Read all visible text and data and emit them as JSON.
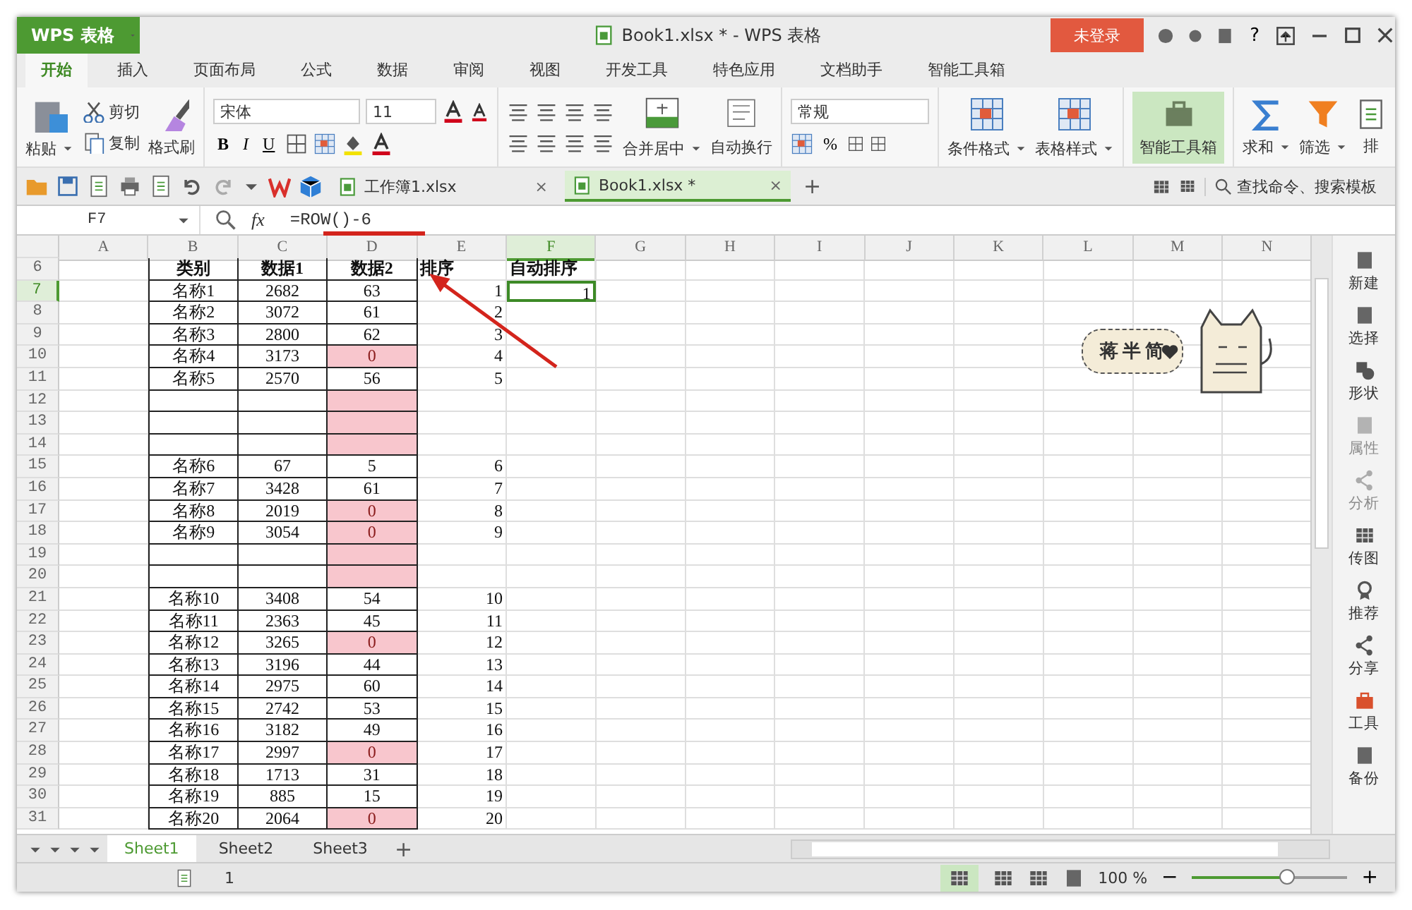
{
  "title_bar": {
    "app": "WPS 表格",
    "document": "Book1.xlsx * - WPS 表格",
    "login": "未登录",
    "help": "?"
  },
  "menu_tabs": [
    {
      "label": "开始",
      "selected": true
    },
    {
      "label": "插入",
      "selected": false
    },
    {
      "label": "页面布局",
      "selected": false
    },
    {
      "label": "公式",
      "selected": false
    },
    {
      "label": "数据",
      "selected": false
    },
    {
      "label": "审阅",
      "selected": false
    },
    {
      "label": "视图",
      "selected": false
    },
    {
      "label": "开发工具",
      "selected": false
    },
    {
      "label": "特色应用",
      "selected": false
    },
    {
      "label": "文档助手",
      "selected": false
    },
    {
      "label": "智能工具箱",
      "selected": false
    }
  ],
  "ribbon": {
    "paste": "粘贴",
    "cut": "剪切",
    "copy": "复制",
    "format_painter": "格式刷",
    "font": "宋体",
    "size": "11",
    "bold": "B",
    "italic": "I",
    "underline": "U",
    "merge": "合并居中",
    "wrap": "自动换行",
    "number_format": "常规",
    "percent": "%",
    "conditional": "条件格式",
    "table_style": "表格样式",
    "toolbox": "智能工具箱",
    "sum": "求和",
    "filter": "筛选",
    "sort": "排"
  },
  "doc_tabs": [
    {
      "label": "工作簿1.xlsx",
      "selected": false,
      "close": "×"
    },
    {
      "label": "Book1.xlsx *",
      "selected": true,
      "close": "×"
    }
  ],
  "new_tab": "+",
  "search": {
    "placeholder": "查找命令、搜索模板"
  },
  "formula_bar": {
    "cell": "F7",
    "fx": "fx",
    "formula": "=ROW()-6"
  },
  "columns": [
    {
      "label": "A",
      "selected": false
    },
    {
      "label": "B",
      "selected": false
    },
    {
      "label": "C",
      "selected": false
    },
    {
      "label": "D",
      "selected": false
    },
    {
      "label": "E",
      "selected": false
    },
    {
      "label": "F",
      "selected": true
    },
    {
      "label": "G",
      "selected": false
    },
    {
      "label": "H",
      "selected": false
    },
    {
      "label": "I",
      "selected": false
    },
    {
      "label": "J",
      "selected": false
    },
    {
      "label": "K",
      "selected": false
    },
    {
      "label": "L",
      "selected": false
    },
    {
      "label": "M",
      "selected": false
    },
    {
      "label": "N",
      "selected": false
    }
  ],
  "rows": [
    {
      "label": "6",
      "kind": "header",
      "selected": false,
      "flagged": false,
      "cells": {
        "B": "类别",
        "C": "数据1",
        "D": "数据2",
        "E": "排序",
        "F": "自动排序"
      }
    },
    {
      "label": "7",
      "kind": "data",
      "selected": true,
      "flagged": false,
      "cells": {
        "B": "名称1",
        "C": "2682",
        "D": "63",
        "E": "1",
        "F": "1"
      }
    },
    {
      "label": "8",
      "kind": "data",
      "selected": false,
      "flagged": false,
      "cells": {
        "B": "名称2",
        "C": "3072",
        "D": "61",
        "E": "2"
      }
    },
    {
      "label": "9",
      "kind": "data",
      "selected": false,
      "flagged": false,
      "cells": {
        "B": "名称3",
        "C": "2800",
        "D": "62",
        "E": "3"
      }
    },
    {
      "label": "10",
      "kind": "data",
      "selected": false,
      "flagged": true,
      "cells": {
        "B": "名称4",
        "C": "3173",
        "D": "0",
        "E": "4"
      }
    },
    {
      "label": "11",
      "kind": "data",
      "selected": false,
      "flagged": false,
      "cells": {
        "B": "名称5",
        "C": "2570",
        "D": "56",
        "E": "5"
      }
    },
    {
      "label": "12",
      "kind": "data",
      "selected": false,
      "flagged": true,
      "cells": {}
    },
    {
      "label": "13",
      "kind": "data",
      "selected": false,
      "flagged": true,
      "cells": {}
    },
    {
      "label": "14",
      "kind": "data",
      "selected": false,
      "flagged": true,
      "cells": {}
    },
    {
      "label": "15",
      "kind": "data",
      "selected": false,
      "flagged": false,
      "cells": {
        "B": "名称6",
        "C": "67",
        "D": "5",
        "E": "6"
      }
    },
    {
      "label": "16",
      "kind": "data",
      "selected": false,
      "flagged": false,
      "cells": {
        "B": "名称7",
        "C": "3428",
        "D": "61",
        "E": "7"
      }
    },
    {
      "label": "17",
      "kind": "data",
      "selected": false,
      "flagged": true,
      "cells": {
        "B": "名称8",
        "C": "2019",
        "D": "0",
        "E": "8"
      }
    },
    {
      "label": "18",
      "kind": "data",
      "selected": false,
      "flagged": true,
      "cells": {
        "B": "名称9",
        "C": "3054",
        "D": "0",
        "E": "9"
      }
    },
    {
      "label": "19",
      "kind": "data",
      "selected": false,
      "flagged": true,
      "cells": {}
    },
    {
      "label": "20",
      "kind": "data",
      "selected": false,
      "flagged": true,
      "cells": {}
    },
    {
      "label": "21",
      "kind": "data",
      "selected": false,
      "flagged": false,
      "cells": {
        "B": "名称10",
        "C": "3408",
        "D": "54",
        "E": "10"
      }
    },
    {
      "label": "22",
      "kind": "data",
      "selected": false,
      "flagged": false,
      "cells": {
        "B": "名称11",
        "C": "2363",
        "D": "45",
        "E": "11"
      }
    },
    {
      "label": "23",
      "kind": "data",
      "selected": false,
      "flagged": true,
      "cells": {
        "B": "名称12",
        "C": "3265",
        "D": "0",
        "E": "12"
      }
    },
    {
      "label": "24",
      "kind": "data",
      "selected": false,
      "flagged": false,
      "cells": {
        "B": "名称13",
        "C": "3196",
        "D": "44",
        "E": "13"
      }
    },
    {
      "label": "25",
      "kind": "data",
      "selected": false,
      "flagged": false,
      "cells": {
        "B": "名称14",
        "C": "2975",
        "D": "60",
        "E": "14"
      }
    },
    {
      "label": "26",
      "kind": "data",
      "selected": false,
      "flagged": false,
      "cells": {
        "B": "名称15",
        "C": "2742",
        "D": "53",
        "E": "15"
      }
    },
    {
      "label": "27",
      "kind": "data",
      "selected": false,
      "flagged": false,
      "cells": {
        "B": "名称16",
        "C": "3182",
        "D": "49",
        "E": "16"
      }
    },
    {
      "label": "28",
      "kind": "data",
      "selected": false,
      "flagged": true,
      "cells": {
        "B": "名称17",
        "C": "2997",
        "D": "0",
        "E": "17"
      }
    },
    {
      "label": "29",
      "kind": "data",
      "selected": false,
      "flagged": false,
      "cells": {
        "B": "名称18",
        "C": "1713",
        "D": "31",
        "E": "18"
      }
    },
    {
      "label": "30",
      "kind": "data",
      "selected": false,
      "flagged": false,
      "cells": {
        "B": "名称19",
        "C": "885",
        "D": "15",
        "E": "19"
      }
    },
    {
      "label": "31",
      "kind": "data",
      "selected": false,
      "flagged": true,
      "cells": {
        "B": "名称20",
        "C": "2064",
        "D": "0",
        "E": "20"
      }
    }
  ],
  "sticker": {
    "text": "蒋半简"
  },
  "side_panel": [
    {
      "label": "新建",
      "disabled": false
    },
    {
      "label": "选择",
      "disabled": false
    },
    {
      "label": "形状",
      "disabled": false
    },
    {
      "label": "属性",
      "disabled": true
    },
    {
      "label": "分析",
      "disabled": true
    },
    {
      "label": "传图",
      "disabled": false
    },
    {
      "label": "推荐",
      "disabled": false
    },
    {
      "label": "分享",
      "disabled": false
    },
    {
      "label": "工具",
      "disabled": false
    },
    {
      "label": "备份",
      "disabled": false
    }
  ],
  "sheet_tabs": [
    {
      "label": "Sheet1",
      "selected": true
    },
    {
      "label": "Sheet2",
      "selected": false
    },
    {
      "label": "Sheet3",
      "selected": false
    }
  ],
  "add_sheet": "+",
  "status_bar": {
    "page": "1",
    "zoom": "100 %",
    "minus": "−",
    "plus": "+",
    "zoom_slider": {
      "level": 0.62
    }
  }
}
